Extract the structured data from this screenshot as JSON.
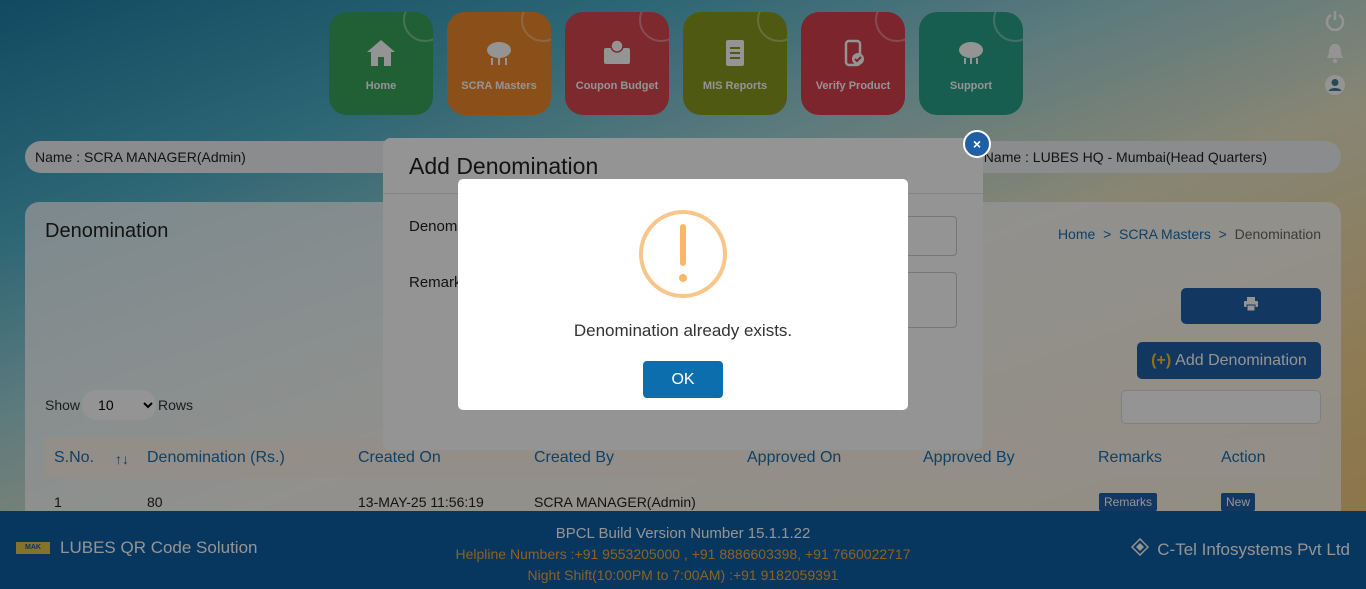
{
  "nav": [
    {
      "label": "Home",
      "icon": "home-icon"
    },
    {
      "label": "SCRA Masters",
      "icon": "cloud-network-icon"
    },
    {
      "label": "Coupon Budget",
      "icon": "coupon-icon"
    },
    {
      "label": "MIS Reports",
      "icon": "report-icon"
    },
    {
      "label": "Verify Product",
      "icon": "verify-icon"
    },
    {
      "label": "Support",
      "icon": "support-icon"
    }
  ],
  "infobar": {
    "name": "Name :  SCRA MANAGER(Admin)",
    "location": "Name :  LUBES HQ - Mumbai(Head Quarters)"
  },
  "page": {
    "title": "Denomination",
    "breadcrumb": {
      "home": "Home",
      "sep": ">",
      "section": "SCRA Masters",
      "current": "Denomination"
    },
    "add_button": "Add Denomination",
    "add_plus": "(+)",
    "show_label": "Show",
    "rows_label": "Rows",
    "rows_value": "10",
    "rows_options": [
      "10"
    ]
  },
  "table": {
    "headers": [
      "S.No.",
      "Denomination (Rs.)",
      "Created On",
      "Created By",
      "Approved On",
      "Approved By",
      "Remarks",
      "Action"
    ],
    "sort_indicator": "↑↓",
    "row": {
      "sno": "1",
      "denomination": "80",
      "created_on": "13-MAY-25 11:56:19",
      "created_by": "SCRA MANAGER(Admin)",
      "approved_on": "",
      "approved_by": "",
      "remarks_btn": "Remarks",
      "action_btn": "New"
    }
  },
  "modal": {
    "title": "Add Denomination",
    "close": "×",
    "label_denomination": "Denomination",
    "label_remarks": "Remarks"
  },
  "alert": {
    "icon": "!",
    "message": "Denomination already exists.",
    "ok": "OK"
  },
  "footer": {
    "logo_text": "MAK",
    "app": "LUBES QR Code Solution",
    "version": "BPCL Build Version Number 15.1.1.22",
    "helpline": "Helpline Numbers :+91 9553205000 , +91 8886603398, +91 7660022717",
    "night": "Night Shift(10:00PM to 7:00AM) :+91 9182059391",
    "company": "C-Tel Infosystems Pvt Ltd"
  },
  "colors": {
    "primary": "#1f5fa6",
    "footer": "#0d5ea3",
    "warning_ring": "#f8c68a",
    "ok_button": "#0d6eae"
  }
}
